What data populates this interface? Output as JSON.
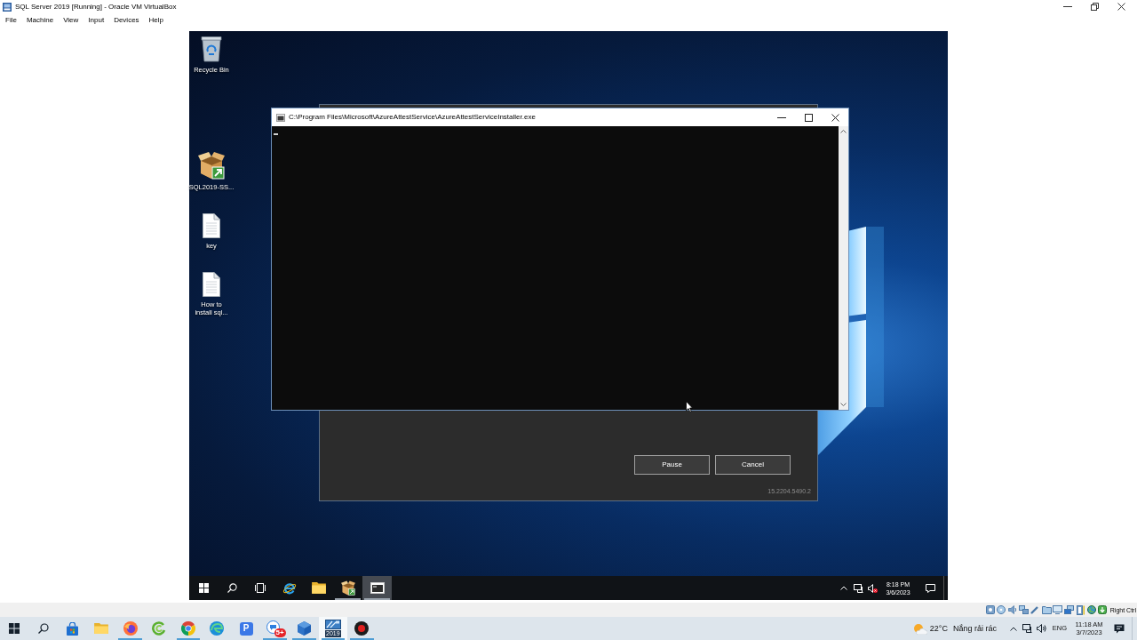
{
  "host_window": {
    "title": "SQL Server 2019 [Running] - Oracle VM VirtualBox",
    "menu": [
      "File",
      "Machine",
      "View",
      "Input",
      "Devices",
      "Help"
    ]
  },
  "desktop_icons": [
    {
      "kind": "bin",
      "label": "Recycle Bin"
    },
    {
      "kind": "package",
      "label": "SQL2019-SS..."
    },
    {
      "kind": "document",
      "label": "key"
    },
    {
      "kind": "document",
      "label": "How to install sql..."
    }
  ],
  "installer_dialog": {
    "buttons": [
      "Pause",
      "Cancel"
    ],
    "version": "15.2204.5490.2"
  },
  "console_window": {
    "title": "C:\\Program Files\\Microsoft\\AzureAttestService\\AzureAttestServiceInstaller.exe"
  },
  "vm_taskbar": {
    "apps": [
      {
        "kind": "orbit",
        "selected": false,
        "running": false
      },
      {
        "kind": "folder",
        "selected": false,
        "running": false
      },
      {
        "kind": "package",
        "selected": false,
        "running": true
      },
      {
        "kind": "console",
        "selected": true,
        "running": true
      }
    ],
    "time": "8:18 PM",
    "date": "3/6/2023"
  },
  "status_bar": {
    "host_key": "Right Ctrl"
  },
  "host_taskbar": {
    "apps": [
      {
        "kind": "bag",
        "selected": false,
        "running": false
      },
      {
        "kind": "folder",
        "selected": false,
        "running": false
      },
      {
        "kind": "fox",
        "selected": false,
        "running": true
      },
      {
        "kind": "swirl",
        "selected": false,
        "running": false
      },
      {
        "kind": "segments",
        "selected": false,
        "running": true
      },
      {
        "kind": "wave",
        "selected": false,
        "running": false
      },
      {
        "kind": "letter",
        "letter": "P",
        "selected": false,
        "running": false
      },
      {
        "kind": "chat",
        "badge": "5+",
        "selected": false,
        "running": true
      },
      {
        "kind": "cube",
        "selected": false,
        "running": true
      },
      {
        "kind": "vm",
        "badge": "2019",
        "selected": true,
        "running": true
      },
      {
        "kind": "record",
        "selected": false,
        "running": true
      }
    ],
    "weather": {
      "temperature": "22°C",
      "condition": "Nắng rải rác"
    },
    "language": "ENG",
    "time": "11:18 AM",
    "date": "3/7/2023"
  }
}
